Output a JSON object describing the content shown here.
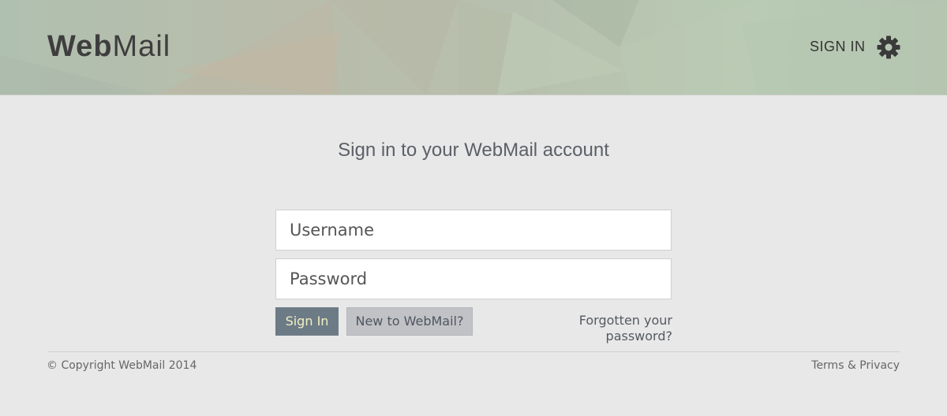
{
  "header": {
    "logo_bold": "Web",
    "logo_regular": "Mail",
    "signin_label": "SIGN IN",
    "settings_icon": "gear-icon"
  },
  "main": {
    "title": "Sign in to your WebMail account",
    "username_placeholder": "Username",
    "password_placeholder": "Password",
    "signin_button": "Sign In",
    "new_account_button": "New to WebMail?",
    "forgot_link": "Forgotten your password?"
  },
  "footer": {
    "copyright": "© Copyright WebMail 2014",
    "terms": "Terms & Privacy"
  },
  "colors": {
    "signin_button_bg": "#6d7b86",
    "signin_button_text": "#f2efc3",
    "page_bg": "#e8e8e8"
  }
}
